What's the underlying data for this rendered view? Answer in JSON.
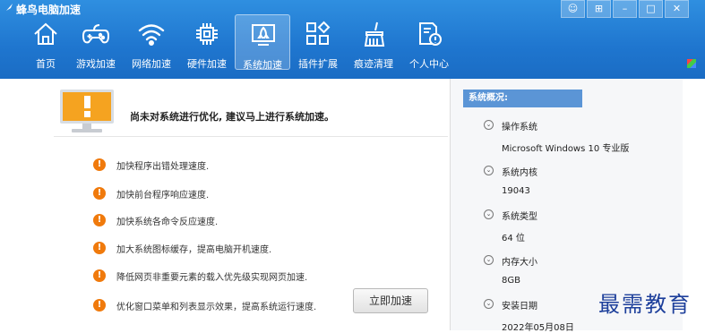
{
  "app": {
    "title": "蜂鸟电脑加速",
    "window_buttons": [
      "☺",
      "⊞",
      "–",
      "□",
      "✕"
    ]
  },
  "tabs": [
    {
      "label": "首页",
      "icon": "home-icon"
    },
    {
      "label": "游戏加速",
      "icon": "gamepad-icon"
    },
    {
      "label": "网络加速",
      "icon": "wifi-icon"
    },
    {
      "label": "硬件加速",
      "icon": "chip-icon"
    },
    {
      "label": "系统加速",
      "icon": "system-rocket-icon",
      "active": true
    },
    {
      "label": "插件扩展",
      "icon": "plugin-grid-icon"
    },
    {
      "label": "痕迹清理",
      "icon": "broom-icon"
    },
    {
      "label": "个人中心",
      "icon": "user-doc-icon"
    }
  ],
  "main": {
    "headline": "尚未对系统进行优化, 建议马上进行系统加速。",
    "items": [
      "加快程序出错处理速度.",
      "加快前台程序响应速度.",
      "加快系统各命令反应速度.",
      "加大系统图标缓存，提高电脑开机速度.",
      "降低网页非重要元素的载入优先级实现网页加速.",
      "优化窗口菜单和列表显示效果，提高系统运行速度."
    ],
    "speed_button": "立即加速",
    "badge_glyph": "!",
    "accent_color": "#f07a0c"
  },
  "system": {
    "header": "系统概况:",
    "rows": [
      {
        "label": "操作系统",
        "value": "Microsoft Windows 10 专业版"
      },
      {
        "label": "系统内核",
        "value": "19043"
      },
      {
        "label": "系统类型",
        "value": "64 位"
      },
      {
        "label": "内存大小",
        "value": "8GB"
      },
      {
        "label": "安装日期",
        "value": "2022年05月08日"
      }
    ]
  },
  "watermark": "最需教育"
}
